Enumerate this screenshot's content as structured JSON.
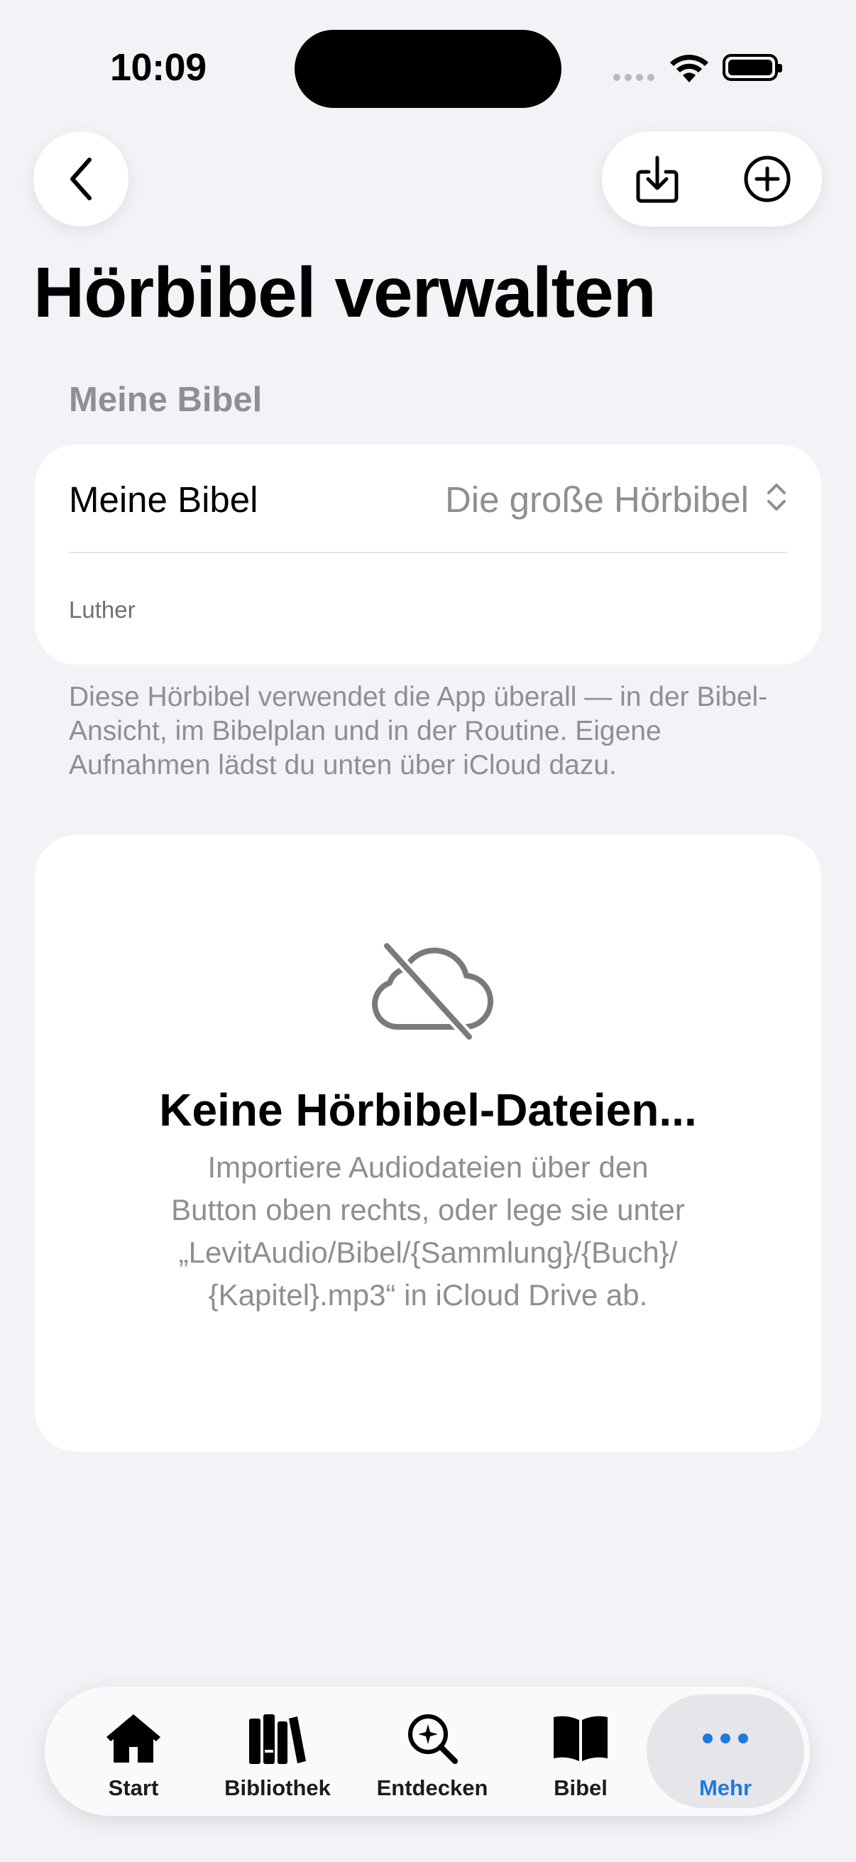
{
  "status_bar": {
    "time": "10:09"
  },
  "nav": {
    "back_icon": "chevron-left-icon",
    "import_icon": "tray-arrow-down-icon",
    "add_icon": "plus-circle-icon"
  },
  "page_title": "Hörbibel verwalten",
  "section": {
    "header": "Meine Bibel",
    "row_label": "Meine Bibel",
    "selected_value": "Die große Hörbibel",
    "subtitle": "Luther",
    "footer": "Diese Hörbibel verwendet die App überall — in der Bibel-Ansicht, im Bibelplan und in der Routine. Eigene Aufnahmen lädst du unten über iCloud dazu."
  },
  "empty_state": {
    "icon": "icloud-slash-icon",
    "title": "Keine Hörbibel-Dateien...",
    "body_line1": "Importiere Audiodateien über den",
    "body_line2": "Button oben rechts, oder lege sie unter",
    "body_line3": "„LevitAudio/Bibel/{Sammlung}/{Buch}/",
    "body_line4": "{Kapitel}.mp3“ in iCloud Drive ab."
  },
  "tabbar": {
    "items": [
      {
        "label": "Start",
        "icon": "house-icon"
      },
      {
        "label": "Bibliothek",
        "icon": "books-icon"
      },
      {
        "label": "Entdecken",
        "icon": "magnifier-sparkle-icon"
      },
      {
        "label": "Bibel",
        "icon": "book-icon"
      },
      {
        "label": "Mehr",
        "icon": "ellipsis-icon",
        "active": true
      }
    ]
  },
  "colors": {
    "accent": "#1f7ae0",
    "background": "#f2f2f7",
    "secondary_text": "#8e8e93"
  }
}
